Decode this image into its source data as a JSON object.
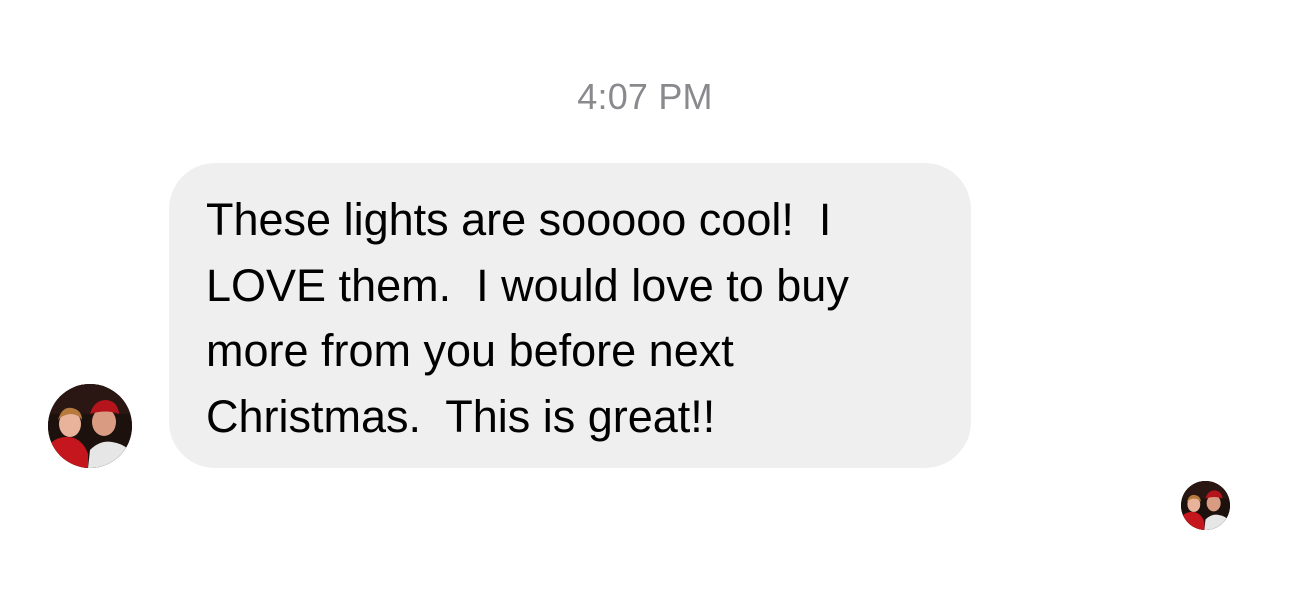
{
  "thread": {
    "timestamp": "4:07 PM"
  },
  "message": {
    "text": "These lights are sooooo cool!  I\nLOVE them.  I would love to buy\nmore from you before next\nChristmas.  This is great!!",
    "sender_avatar_icon": "contact-photo-icon"
  },
  "read_receipt": {
    "avatar_icon": "contact-photo-icon"
  },
  "colors": {
    "bubble_background": "#efefef",
    "timestamp_text": "#8a8a8e",
    "message_text": "#000000"
  }
}
